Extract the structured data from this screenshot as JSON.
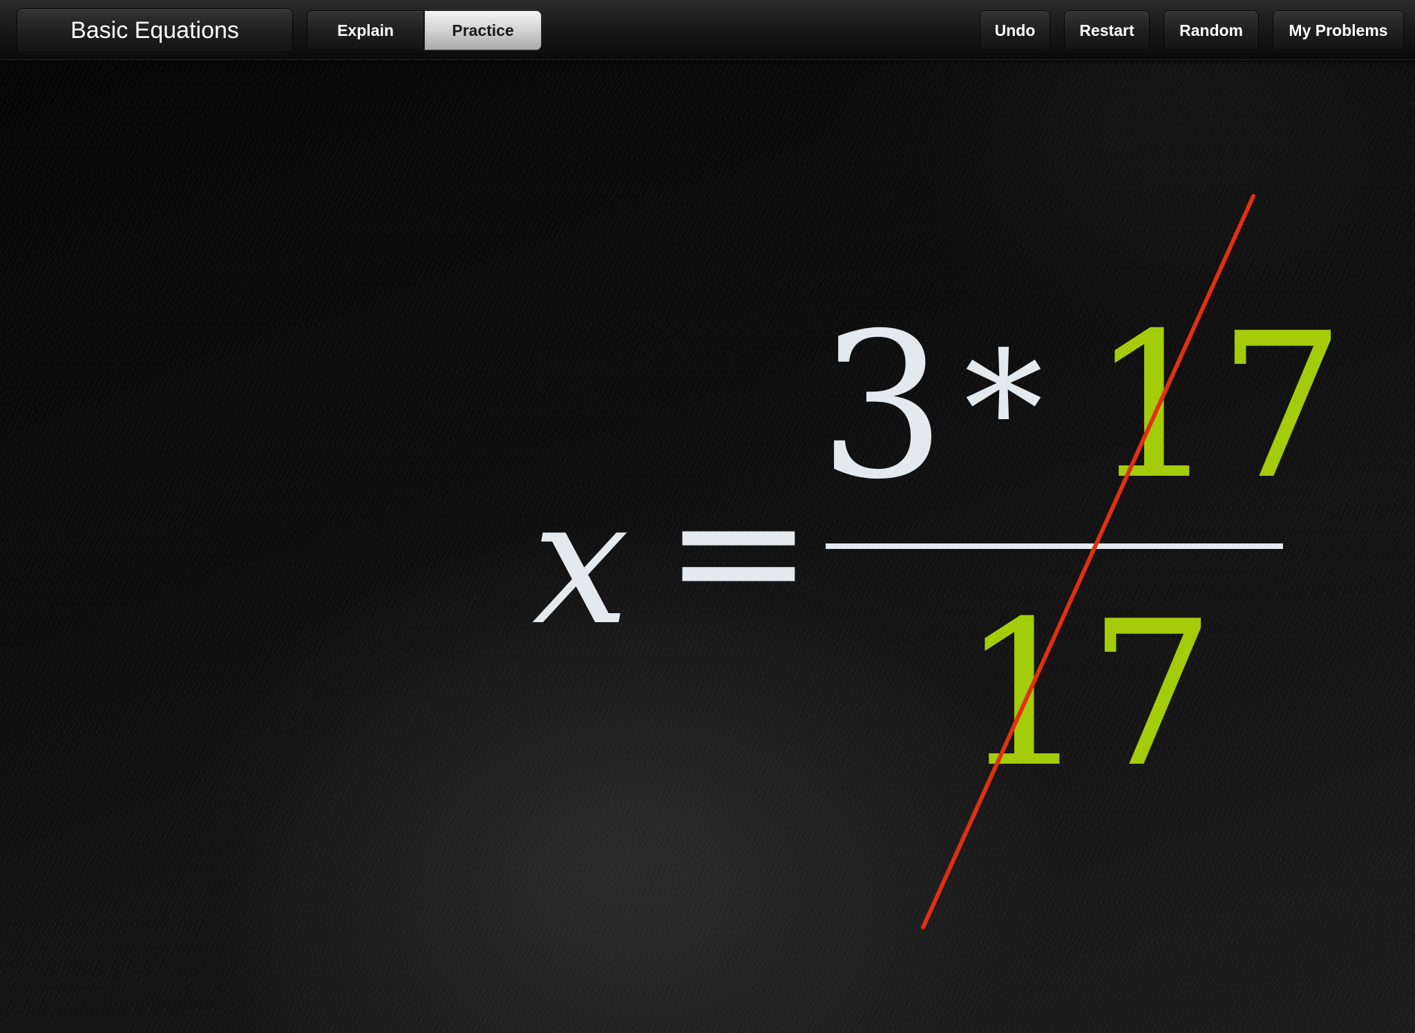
{
  "toolbar": {
    "title": "Basic Equations",
    "mode_tabs": [
      {
        "label": "Explain",
        "selected": false
      },
      {
        "label": "Practice",
        "selected": true
      }
    ],
    "actions": {
      "undo": "Undo",
      "restart": "Restart",
      "random": "Random",
      "my_problems": "My Problems"
    }
  },
  "equation": {
    "variable": "x",
    "equals": "=",
    "numerator": {
      "left": "3",
      "operator": "*",
      "right": "17"
    },
    "denominator": "17",
    "highlight_color": "#a4cc0a",
    "cancel_line_color": "#e03010",
    "text_color": "#e4e9ee"
  }
}
